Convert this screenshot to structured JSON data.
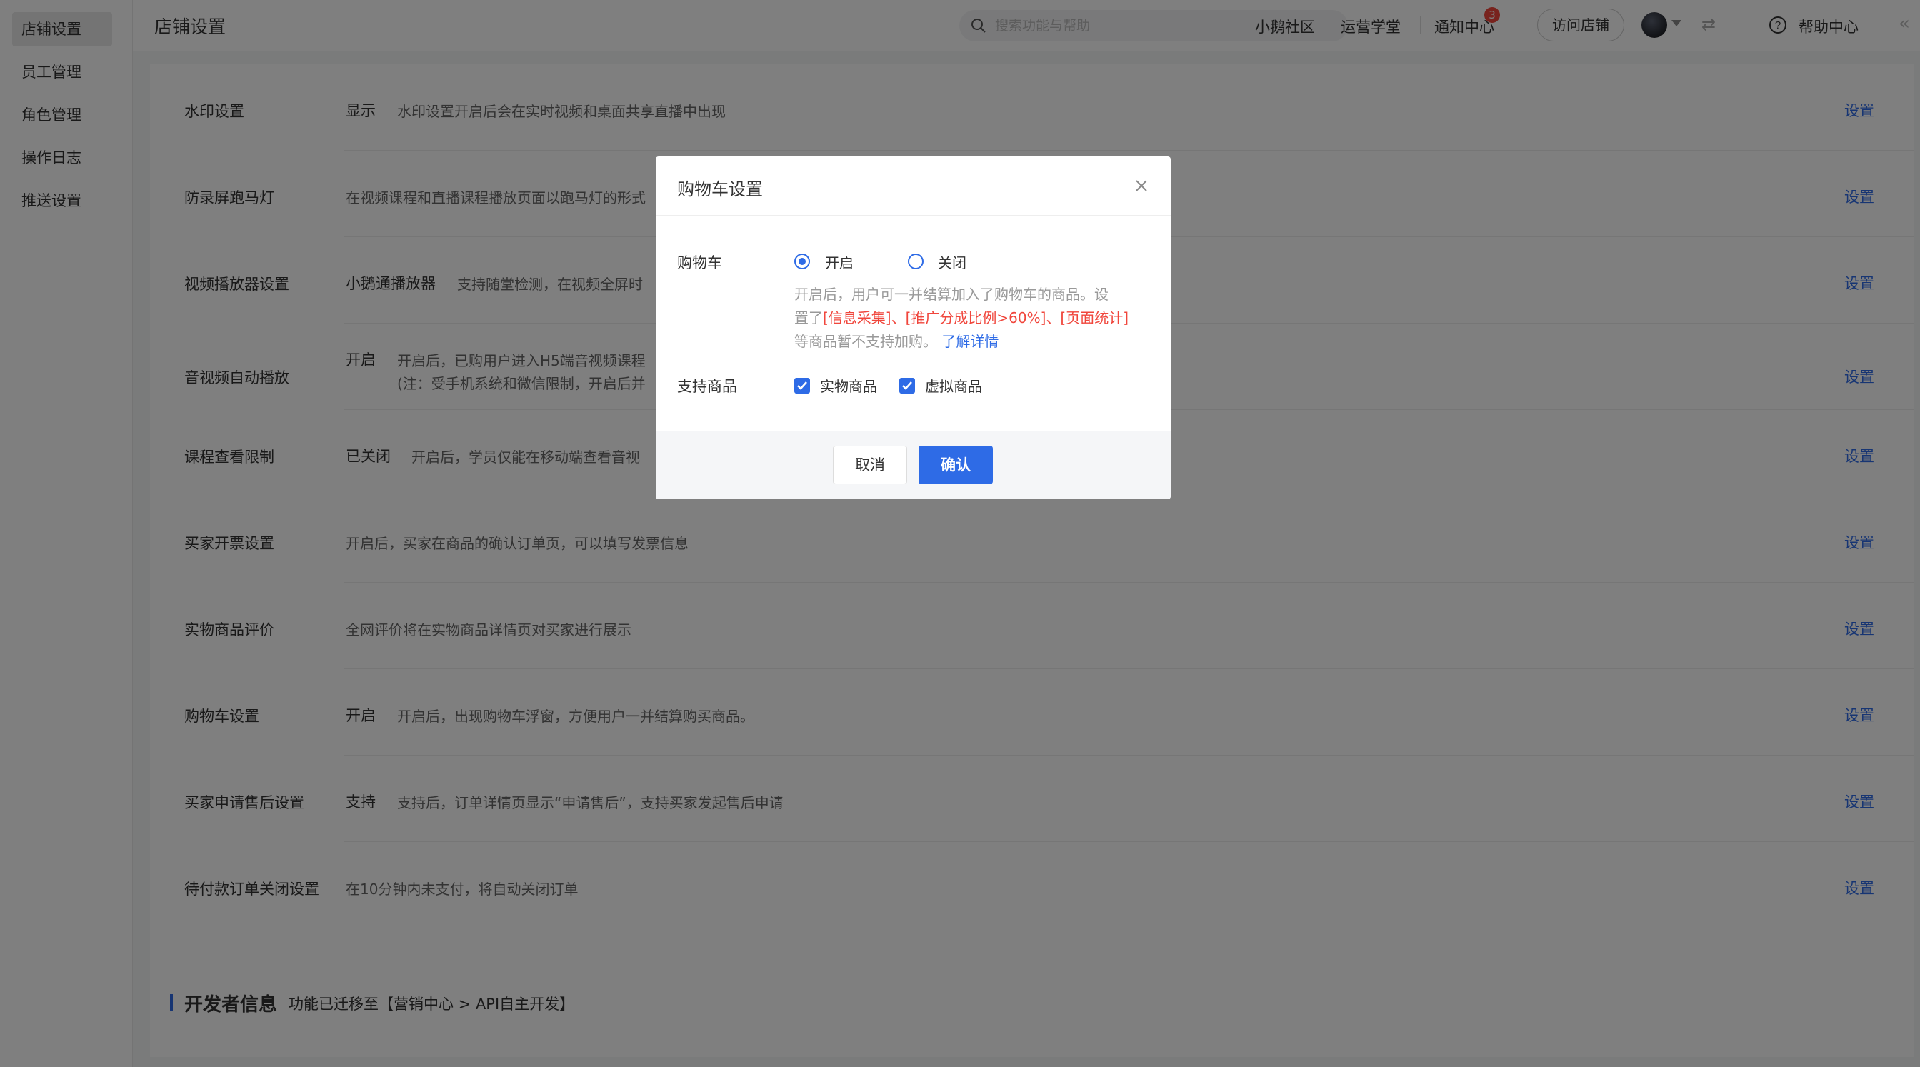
{
  "sidebar": {
    "items": [
      {
        "label": "店铺设置",
        "active": true
      },
      {
        "label": "员工管理"
      },
      {
        "label": "角色管理"
      },
      {
        "label": "操作日志"
      },
      {
        "label": "推送设置"
      }
    ]
  },
  "header": {
    "title": "店铺设置",
    "search_placeholder": "搜索功能与帮助",
    "nav": [
      "小鹅社区",
      "运营学堂",
      "通知中心"
    ],
    "notification_count": "3",
    "visit_store": "访问店铺",
    "help": "帮助中心"
  },
  "settings": [
    {
      "label": "水印设置",
      "value": "显示",
      "desc": "水印设置开启后会在实时视频和桌面共享直播中出现",
      "action": "设置"
    },
    {
      "label": "防录屏跑马灯",
      "value": "",
      "desc": "在视频课程和直播课程播放页面以跑马灯的形式",
      "action": "设置"
    },
    {
      "label": "视频播放器设置",
      "value": "小鹅通播放器",
      "desc": "支持随堂检测，在视频全屏时",
      "action": "设置"
    },
    {
      "label": "音视频自动播放",
      "value": "开启",
      "desc": "开启后，已购用户进入H5端音视频课程",
      "desc2": "(注：受手机系统和微信限制，开启后并",
      "action": "设置"
    },
    {
      "label": "课程查看限制",
      "value": "已关闭",
      "desc": "开启后，学员仅能在移动端查看音视",
      "action": "设置"
    },
    {
      "label": "买家开票设置",
      "value": "",
      "desc": "开启后，买家在商品的确认订单页，可以填写发票信息",
      "action": "设置"
    },
    {
      "label": "实物商品评价",
      "value": "",
      "desc": "全网评价将在实物商品详情页对买家进行展示",
      "action": "设置"
    },
    {
      "label": "购物车设置",
      "value": "开启",
      "desc": "开启后，出现购物车浮窗，方便用户一并结算购买商品。",
      "action": "设置"
    },
    {
      "label": "买家申请售后设置",
      "value": "支持",
      "desc": "支持后，订单详情页显示“申请售后”，支持买家发起售后申请",
      "action": "设置"
    },
    {
      "label": "待付款订单关闭设置",
      "value": "",
      "desc": "在10分钟内未支付，将自动关闭订单",
      "action": "设置"
    }
  ],
  "developer": {
    "title": "开发者信息",
    "desc": "功能已迁移至【营销中心 > API自主开发】"
  },
  "modal": {
    "title": "购物车设置",
    "cart_label": "购物车",
    "option_on": "开启",
    "option_off": "关闭",
    "hint_line1": "开启后，用户可一并结算加入了购物车的商品。设",
    "hint_line2_prefix": "置了",
    "hint_line2_red": "[信息采集]、[推广分成比例>60%]、[页面统计]",
    "hint_line3": "等商品暂不支持加购。",
    "hint_link": "了解详情",
    "goods_label": "支持商品",
    "goods_physical": "实物商品",
    "goods_virtual": "虚拟商品",
    "cancel": "取消",
    "confirm": "确认"
  },
  "colors": {
    "accent": "#2e6be6",
    "warning": "#f0463c"
  }
}
